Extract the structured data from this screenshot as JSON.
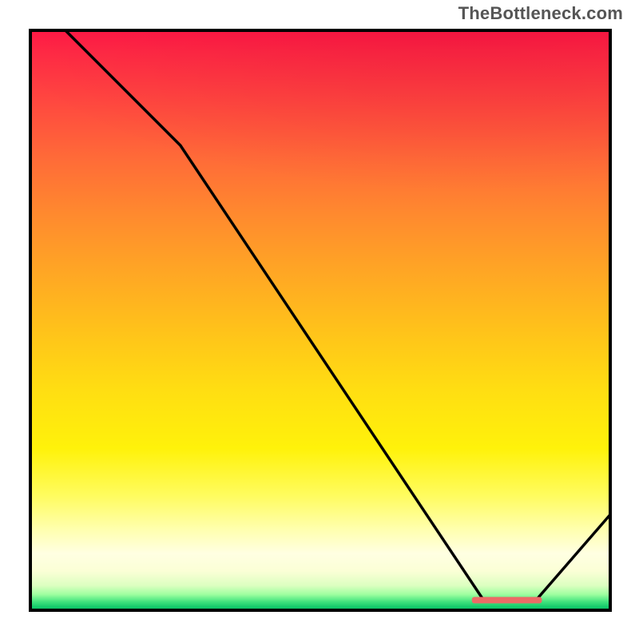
{
  "watermark": "TheBottleneck.com",
  "chart_data": {
    "type": "line",
    "title": "",
    "xlabel": "",
    "ylabel": "",
    "xlim": [
      0,
      1
    ],
    "ylim": [
      0,
      1
    ],
    "grid": false,
    "legend": false,
    "series": [
      {
        "name": "curve",
        "x": [
          0.06,
          0.26,
          0.78,
          0.87,
          1.0
        ],
        "values": [
          1.0,
          0.8,
          0.02,
          0.02,
          0.17
        ]
      }
    ],
    "optimal_band": {
      "x_start": 0.76,
      "x_end": 0.88,
      "y": 0.02
    },
    "background_gradient": {
      "direction": "top-to-bottom",
      "stops": [
        {
          "pos": 0.0,
          "color": "#ff1846"
        },
        {
          "pos": 0.3,
          "color": "#ff7a30"
        },
        {
          "pos": 0.6,
          "color": "#ffd816"
        },
        {
          "pos": 0.85,
          "color": "#ffffcc"
        },
        {
          "pos": 0.97,
          "color": "#9fffa0"
        },
        {
          "pos": 1.0,
          "color": "#0ab85f"
        }
      ]
    },
    "frame_color": "#000000",
    "marker_color": "#ec6b66"
  }
}
